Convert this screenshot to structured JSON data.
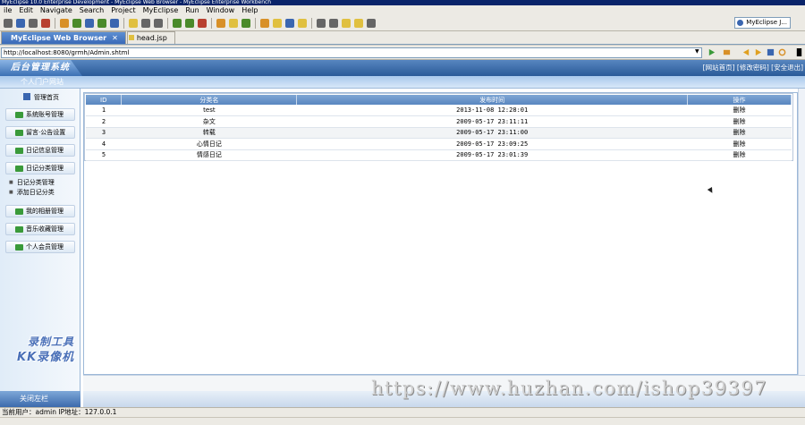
{
  "window": {
    "title": "MyEclipse 10.0 Enterprise Development - MyEclipse Web Browser - MyEclipse Enterprise Workbench"
  },
  "menu": [
    "ile",
    "Edit",
    "Navigate",
    "Search",
    "Project",
    "MyEclipse",
    "Run",
    "Window",
    "Help"
  ],
  "perspective": {
    "label": "MyEclipse J..."
  },
  "tabs": [
    {
      "label": "MyEclipse Web Browser",
      "close": "✕"
    },
    {
      "label": "head.jsp"
    }
  ],
  "browser": {
    "url": "http://localhost:8080/grmh/Admin.shtml"
  },
  "site": {
    "logo": "后台管理系统",
    "top_links": "[网站首页] [修改密码] [安全退出]",
    "portal_label": "个人门户网站"
  },
  "sidebar": {
    "home": "管理首页",
    "buttons": [
      "系统账号管理",
      "留言·公告设置",
      "日记信息管理",
      "日记分类管理"
    ],
    "sub_items": [
      "日记分类管理",
      "添加日记分类"
    ],
    "buttons2": [
      "我的相册管理",
      "音乐收藏管理",
      "个人会员管理"
    ],
    "footer": "关闭左栏"
  },
  "table": {
    "headers": [
      "ID",
      "分类名",
      "发布时间",
      "操作"
    ],
    "rows": [
      {
        "id": "1",
        "name": "test",
        "time": "2013-11-08 12:28:01",
        "action": "删除"
      },
      {
        "id": "2",
        "name": "杂文",
        "time": "2009-05-17 23:11:11",
        "action": "删除"
      },
      {
        "id": "3",
        "name": "转载",
        "time": "2009-05-17 23:11:00",
        "action": "删除"
      },
      {
        "id": "4",
        "name": "心情日记",
        "time": "2009-05-17 23:09:25",
        "action": "删除"
      },
      {
        "id": "5",
        "name": "情感日记",
        "time": "2009-05-17 23:01:39",
        "action": "删除"
      }
    ]
  },
  "status": {
    "text": "当前用户：admin  IP地址：127.0.0.1"
  },
  "watermark": {
    "line1": "录制工具",
    "line2": "KK录像机"
  },
  "overlay_url": "https://www.huzhan.com/ishop39397",
  "colors": {
    "header_blue": "#2a5a98",
    "tab_active": "#3a6ab8",
    "table_header": "#5886c0"
  }
}
